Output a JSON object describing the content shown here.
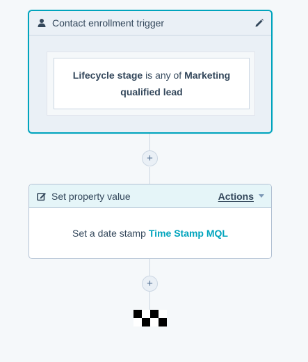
{
  "trigger": {
    "title": "Contact enrollment trigger",
    "icon": "contact-person-icon",
    "edit_icon": "pencil-icon",
    "filter": {
      "property": "Lifecycle stage",
      "operator": "is any of",
      "value": "Marketing qualified lead"
    }
  },
  "action": {
    "icon": "edit-square-icon",
    "title": "Set property value",
    "menu_label": "Actions",
    "body_prefix": "Set a date stamp",
    "property_link": "Time Stamp MQL"
  },
  "colors": {
    "accent": "#00a4bd",
    "text": "#33475b",
    "background": "#f5f8fa",
    "border": "#cbd6e2"
  },
  "add_step_buttons": [
    "+",
    "+"
  ],
  "end_icon": "checkered-flag-icon"
}
